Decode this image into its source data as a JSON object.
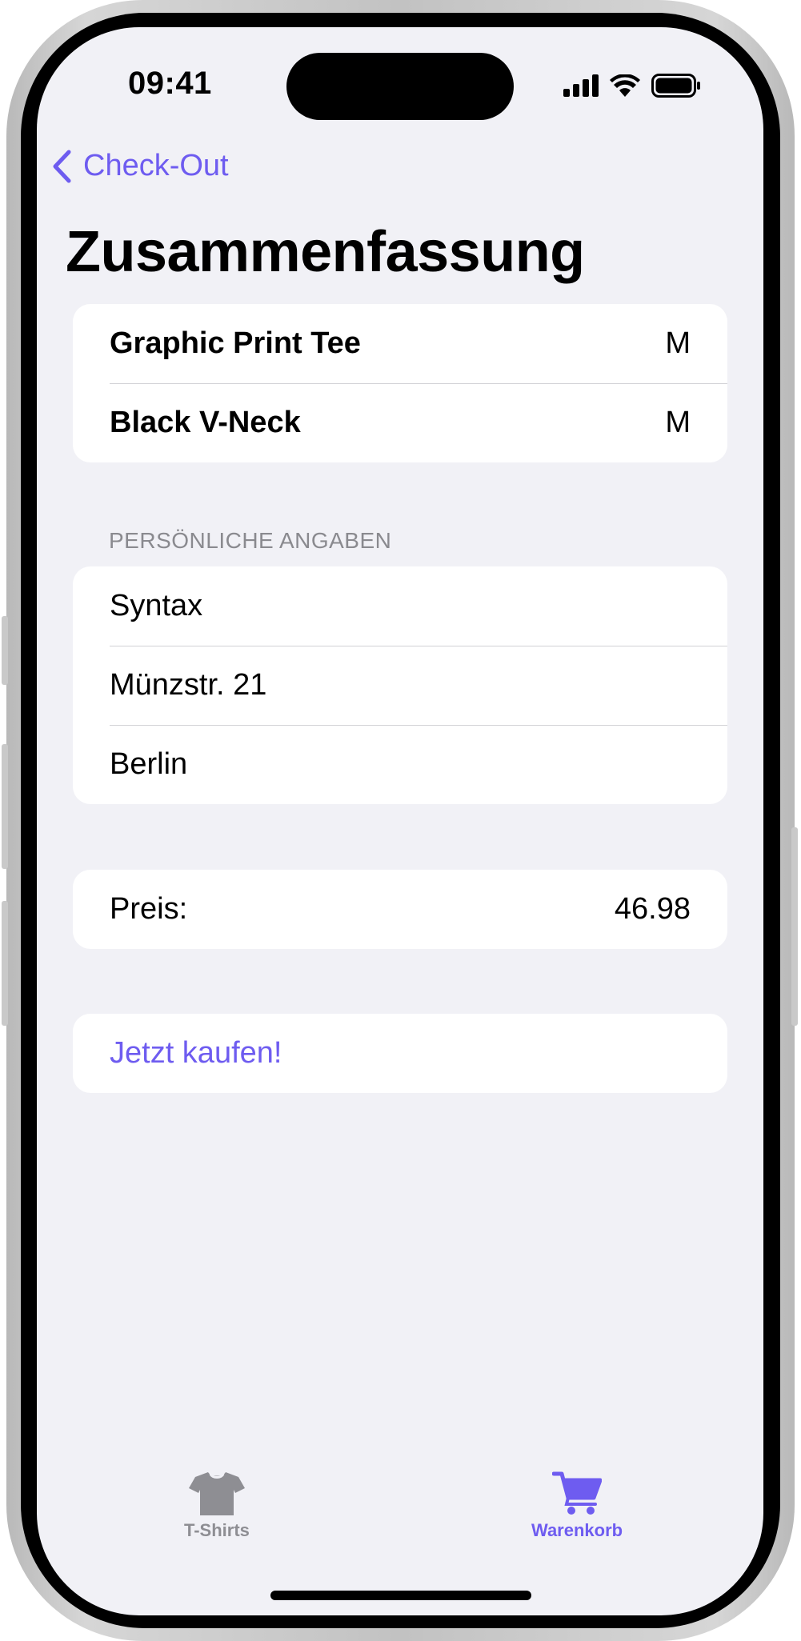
{
  "status_bar": {
    "time": "09:41",
    "icons": [
      "cellular-signal-icon",
      "wifi-icon",
      "battery-icon"
    ]
  },
  "nav": {
    "back_label": "Check-Out",
    "back_icon": "chevron-left-icon",
    "title": "Zusammenfassung"
  },
  "items": [
    {
      "name": "Graphic Print Tee",
      "size": "M"
    },
    {
      "name": "Black V-Neck",
      "size": "M"
    }
  ],
  "personal": {
    "header": "PERSÖNLICHE ANGABEN",
    "name": "Syntax",
    "street": "Münzstr. 21",
    "city": "Berlin"
  },
  "price": {
    "label": "Preis:",
    "value": "46.98"
  },
  "buy": {
    "label": "Jetzt kaufen!"
  },
  "tab_bar": {
    "tabs": [
      {
        "label": "T-Shirts",
        "icon": "tshirt-icon",
        "selected": false
      },
      {
        "label": "Warenkorb",
        "icon": "cart-icon",
        "selected": true
      }
    ]
  },
  "colors": {
    "accent": "#6e5cf0",
    "background": "#f1f1f6",
    "inactive_tab": "#8e8e93",
    "section_header": "#8a8a8f"
  }
}
